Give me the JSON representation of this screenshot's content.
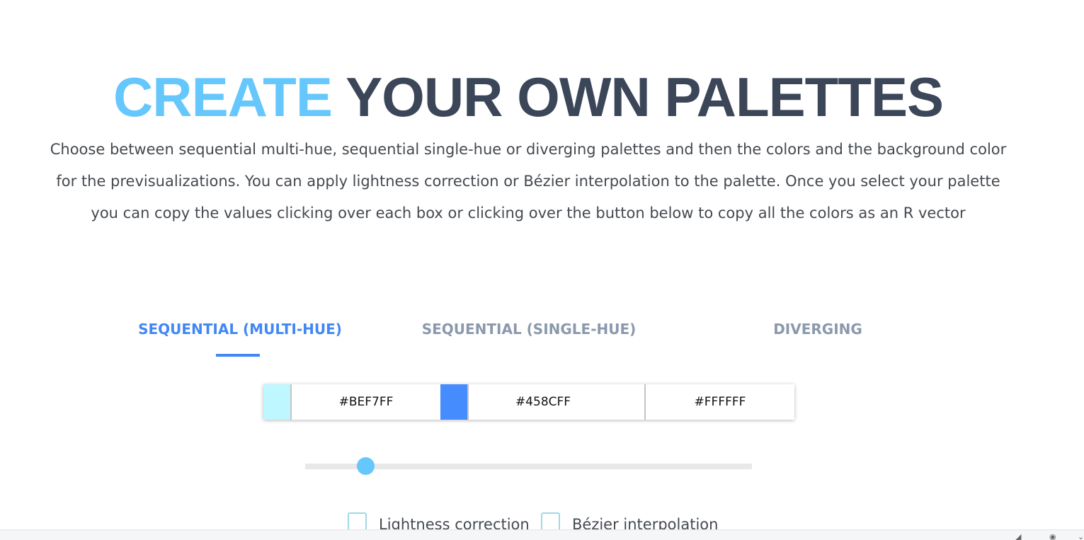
{
  "header": {
    "title_accent": "CREATE",
    "title_rest": "YOUR OWN PALETTES"
  },
  "intro": {
    "text": "Choose between sequential multi-hue, sequential single-hue or diverging palettes and then the colors and the background color for the previsualizations. You can apply lightness correction or Bézier interpolation to the palette. Once you select your palette you can copy the values clicking over each box or clicking over the button below to copy all the colors as an R vector"
  },
  "tabs": [
    {
      "label": "SEQUENTIAL (MULTI-HUE)",
      "active": true
    },
    {
      "label": "SEQUENTIAL (SINGLE-HUE)",
      "active": false
    },
    {
      "label": "DIVERGING",
      "active": false
    }
  ],
  "colors": [
    {
      "hex": "#BEF7FF",
      "swatch": "#BEF7FF"
    },
    {
      "hex": "#458CFF",
      "swatch": "#458CFF"
    },
    {
      "hex": "#FFFFFF",
      "swatch": "#FFFFFF"
    }
  ],
  "slider": {
    "value_fraction": 0.12,
    "thumb_color": "#66C7FC"
  },
  "options": [
    {
      "label": "Lightness correction",
      "checked": false
    },
    {
      "label": "Bézier interpolation",
      "checked": false
    }
  ],
  "theme": {
    "accent": "#66C7FC",
    "title": "#3C4659",
    "tab_active": "#4287F5",
    "tab_inactive": "#8B99AD"
  },
  "statusbar": {
    "icons": [
      "pin-icon",
      "palette-icon",
      "chevron-down-icon"
    ]
  }
}
